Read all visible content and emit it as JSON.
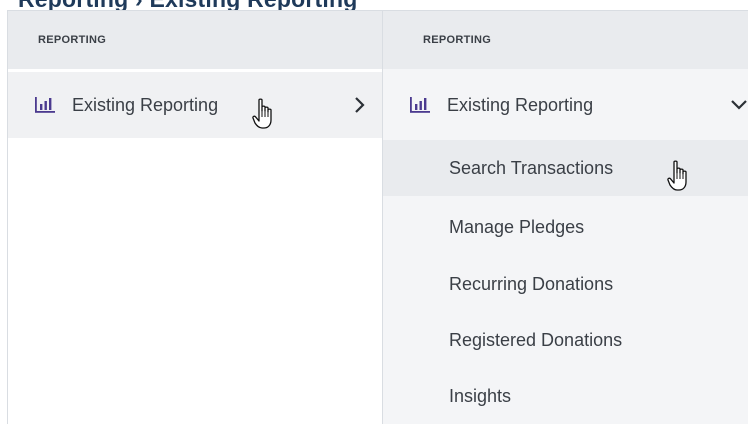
{
  "left_panel": {
    "section_header": "REPORTING",
    "main_item": {
      "label": "Existing Reporting",
      "icon": "bar-chart-icon",
      "chevron": "chevron-right-icon"
    }
  },
  "right_panel": {
    "section_header": "REPORTING",
    "main_item": {
      "label": "Existing Reporting",
      "icon": "bar-chart-icon",
      "chevron": "chevron-down-icon"
    },
    "submenu": [
      {
        "label": "Search Transactions"
      },
      {
        "label": "Manage Pledges"
      },
      {
        "label": "Recurring Donations"
      },
      {
        "label": "Registered Donations"
      },
      {
        "label": "Insights"
      }
    ]
  },
  "colors": {
    "accent": "#1f3a5a",
    "icon": "#4b3a8f",
    "active_bg": "#e9ebee"
  }
}
